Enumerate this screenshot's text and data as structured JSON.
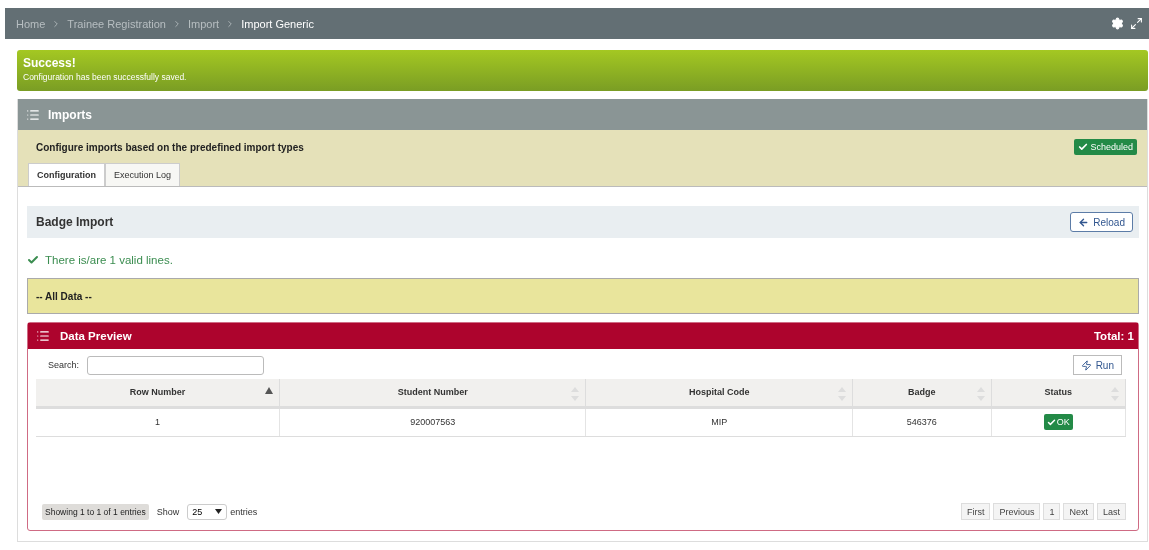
{
  "breadcrumb": [
    {
      "label": "Home",
      "current": false
    },
    {
      "label": "Trainee Registration",
      "current": false
    },
    {
      "label": "Import",
      "current": false
    },
    {
      "label": "Import Generic",
      "current": true
    }
  ],
  "alert": {
    "title": "Success!",
    "message": "Configuration has been successfully saved."
  },
  "panel": {
    "title": "Imports",
    "description": "Configure imports based on the predefined import types",
    "badge": "Scheduled"
  },
  "tabs": [
    {
      "label": "Configuration",
      "selected": true
    },
    {
      "label": "Execution Log",
      "selected": false
    }
  ],
  "section": {
    "title": "Badge Import",
    "reload": "Reload",
    "valid_message": "There is/are 1 valid lines.",
    "filter": "-- All Data --"
  },
  "preview": {
    "title": "Data Preview",
    "total": "Total: 1",
    "search_label": "Search:",
    "run": "Run"
  },
  "table": {
    "columns": [
      {
        "label": "Row Number",
        "sorted": true
      },
      {
        "label": "Student Number",
        "sorted": false
      },
      {
        "label": "Hospital Code",
        "sorted": false
      },
      {
        "label": "Badge",
        "sorted": false
      },
      {
        "label": "Status",
        "sorted": false
      }
    ],
    "rows": [
      {
        "cells": [
          "1",
          "920007563",
          "MIP",
          "546376"
        ],
        "status": "OK"
      }
    ]
  },
  "footer": {
    "info": "Showing 1 to 1 of 1 entries",
    "show": "Show",
    "page_size": "25",
    "entries": "entries",
    "pages": [
      "First",
      "Previous",
      "1",
      "Next",
      "Last"
    ]
  }
}
